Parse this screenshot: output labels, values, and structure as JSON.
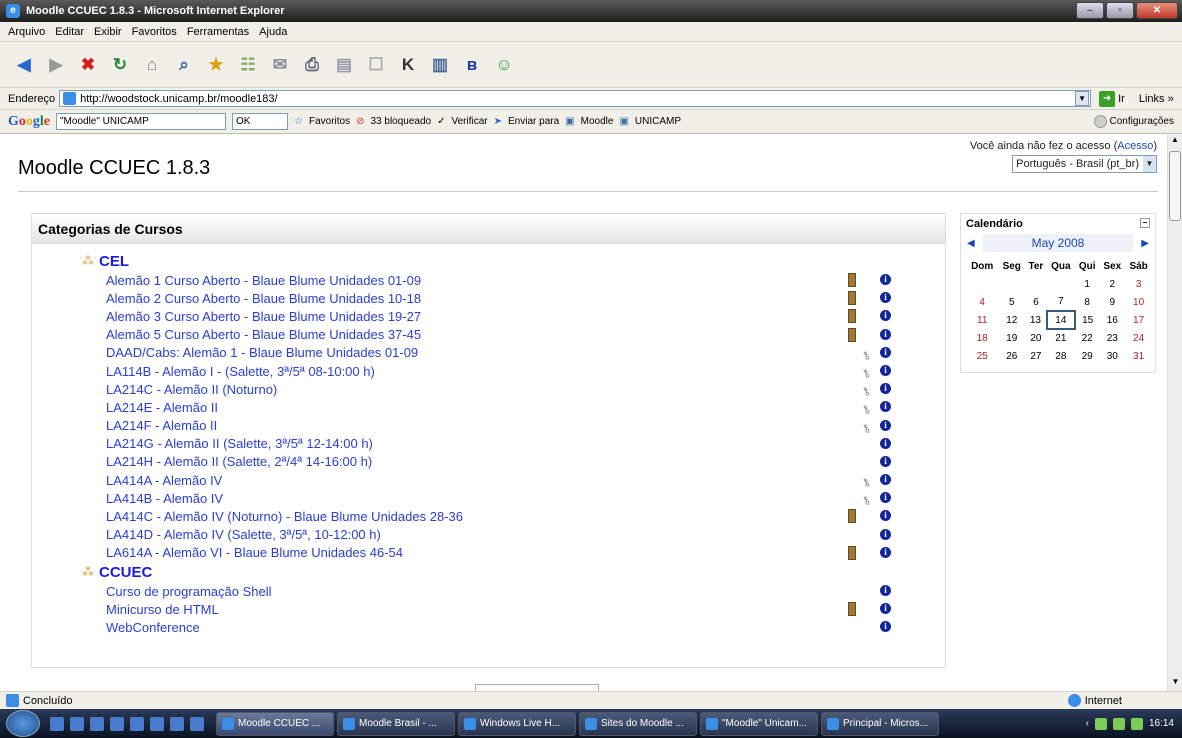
{
  "window": {
    "title": "Moodle CCUEC 1.8.3 - Microsoft Internet Explorer"
  },
  "menu": [
    "Arquivo",
    "Editar",
    "Exibir",
    "Favoritos",
    "Ferramentas",
    "Ajuda"
  ],
  "address": {
    "label": "Endereço",
    "url": "http://woodstock.unicamp.br/moodle183/",
    "go_label": "Ir",
    "links_label": "Links »"
  },
  "googlebar": {
    "search_value": "\"Moodle\" UNICAMP",
    "ok_label": "OK",
    "favorites_label": "Favoritos",
    "blocked_label": "33 bloqueado",
    "verify_label": "Verificar",
    "send_label": "Enviar para",
    "moodle_label": "Moodle",
    "unicamp_label": "UNICAMP",
    "config_label": "Configurações"
  },
  "page": {
    "site_title": "Moodle CCUEC 1.8.3",
    "login_text": "Você ainda não fez o acesso (",
    "login_link": "Acesso",
    "login_close": ")",
    "language": "Português - Brasil (pt_br)"
  },
  "categories": {
    "heading": "Categorias de Cursos",
    "cel_name": "CEL",
    "cel_courses": [
      "Alemão 1 Curso Aberto - Blaue Blume Unidades 01-09",
      "Alemão 2 Curso Aberto - Blaue Blume Unidades 10-18",
      "Alemão 3 Curso Aberto - Blaue Blume Unidades 19-27",
      "Alemão 5 Curso Aberto - Blaue Blume Unidades 37-45",
      "DAAD/Cabs: Alemão 1 - Blaue Blume Unidades 01-09",
      "LA114B - Alemão I - (Salette, 3ª/5ª 08-10:00 h)",
      "LA214C - Alemão II (Noturno)",
      "LA214E - Alemão II",
      "LA214F - Alemão II",
      "LA214G - Alemão II (Salette, 3ª/5ª 12-14:00 h)",
      "LA214H - Alemão II (Salette, 2ª/4ª 14-16:00 h)",
      "LA414A - Alemão IV",
      "LA414B - Alemão IV",
      "LA414C - Alemão IV (Noturno) - Blaue Blume Unidades 28-36",
      "LA414D - Alemão IV (Salette, 3ª/5ª, 10-12:00 h)",
      "LA614A - Alemão VI - Blaue Blume Unidades 46-54"
    ],
    "ccuec_name": "CCUEC",
    "ccuec_courses": [
      "Curso de programação Shell",
      "Minicurso de HTML",
      "WebConference"
    ]
  },
  "calendar": {
    "title": "Calendário",
    "month": "May 2008",
    "days": [
      "Dom",
      "Seg",
      "Ter",
      "Qua",
      "Qui",
      "Sex",
      "Sáb"
    ],
    "week1": [
      "1",
      "2",
      "3"
    ],
    "week2": [
      "4",
      "5",
      "6",
      "7",
      "8",
      "9",
      "10"
    ],
    "week3": [
      "11",
      "12",
      "13",
      "14",
      "15",
      "16",
      "17"
    ],
    "week4": [
      "18",
      "19",
      "20",
      "21",
      "22",
      "23",
      "24"
    ],
    "week5": [
      "25",
      "26",
      "27",
      "28",
      "29",
      "30",
      "31"
    ]
  },
  "status": {
    "left": "Concluído",
    "zone": "Internet"
  },
  "taskbar": {
    "tasks": [
      "Moodle CCUEC ...",
      "Moodle Brasil - ...",
      "Windows Live H...",
      "Sites do Moodle ...",
      "\"Moodle\" Unicam...",
      "Principal - Micros..."
    ],
    "time": "16:14"
  }
}
